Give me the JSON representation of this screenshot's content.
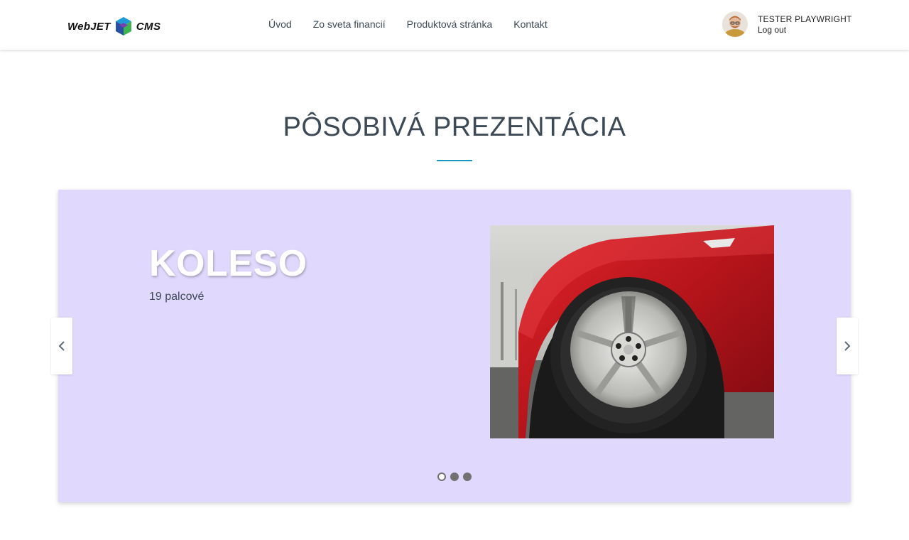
{
  "header": {
    "logo": {
      "left_text": "WebJET",
      "right_text": "CMS"
    },
    "nav": [
      "Úvod",
      "Zo sveta financií",
      "Produktová stránka",
      "Kontakt"
    ],
    "user": {
      "name": "TESTER PLAYWRIGHT",
      "logout_label": "Log out"
    }
  },
  "section": {
    "title": "PÔSOBIVÁ PREZENTÁCIA"
  },
  "slider": {
    "background_color": "#e1d9fd",
    "heading": "KOLESO",
    "subheading": "19 palcové",
    "active_slide": 1,
    "slide_count": 3,
    "prev_icon": "chevron-left-icon",
    "next_icon": "chevron-right-icon"
  },
  "colors": {
    "accent": "#1596c4",
    "text": "#3d4a56"
  }
}
